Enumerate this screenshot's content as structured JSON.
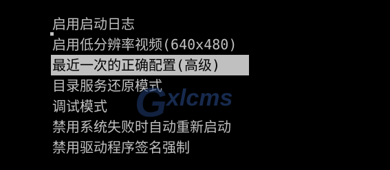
{
  "boot_menu": {
    "selected_index": 2,
    "items": [
      {
        "label": "启用启动日志"
      },
      {
        "label": "启用低分辨率视频(640x480)"
      },
      {
        "label": "最近一次的正确配置(高级)"
      },
      {
        "label": "目录服务还原模式"
      },
      {
        "label": "调试模式"
      },
      {
        "label": "禁用系统失败时自动重新启动"
      },
      {
        "label": "禁用驱动程序签名强制"
      }
    ]
  },
  "watermark": {
    "text": "xlcms",
    "logo_letter": "G"
  },
  "colors": {
    "background": "#000000",
    "text": "#c0c0c0",
    "highlight_bg": "#c0c0c0",
    "highlight_text": "#000000",
    "watermark": "#2a4d8f"
  }
}
